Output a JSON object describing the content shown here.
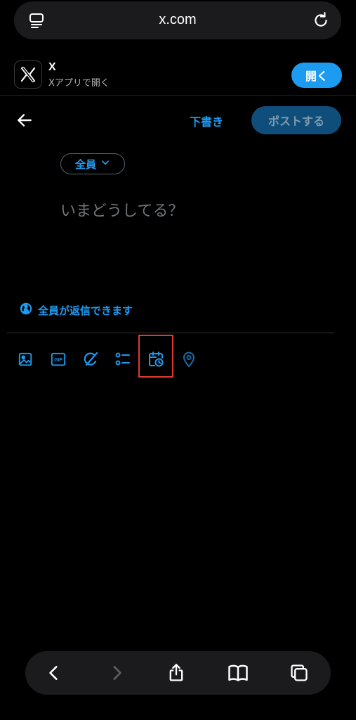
{
  "browser": {
    "address": "x.com",
    "tabs_icon": "tab-list-icon",
    "reload_icon": "reload-icon"
  },
  "banner": {
    "app_name": "X",
    "app_subtitle": "Xアプリで開く",
    "open_label": "開く"
  },
  "compose": {
    "drafts_label": "下書き",
    "post_label": "ポストする",
    "audience_label": "全員",
    "placeholder": "いまどうしてる？",
    "reply_setting": "全員が返信できます"
  },
  "toolbar": {
    "icons": [
      "image-icon",
      "gif-icon",
      "grok-icon",
      "poll-icon",
      "schedule-icon",
      "location-icon"
    ],
    "highlighted": "schedule-icon"
  },
  "colors": {
    "accent": "#1d9bf0",
    "background": "#000000",
    "post_button_disabled": "#0f4e7a",
    "highlight": "#e03a2e"
  }
}
